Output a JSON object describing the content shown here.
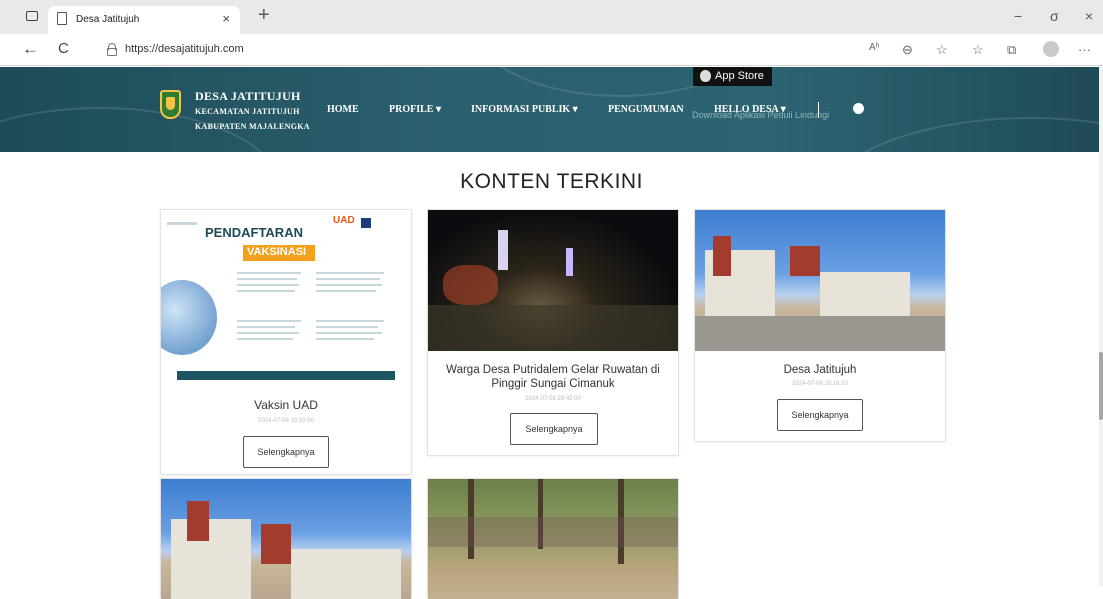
{
  "browser": {
    "tab_title": "Desa Jatitujuh",
    "tab_close": "×",
    "new_tab": "+",
    "url": "https://desajatitujuh.com",
    "nav": {
      "back": "←",
      "refresh": "C"
    },
    "window_controls": {
      "minimize": "−",
      "maximize": "σ",
      "close": "×"
    },
    "toolbar_icons": [
      "read-aloud-icon",
      "zoom-icon",
      "favorites-add-icon",
      "favorites-icon",
      "collections-icon",
      "profile-icon",
      "more-icon"
    ],
    "toolbar_glyphs": {
      "read_aloud": "Aʰ",
      "zoom": "⊖",
      "fav_add": "☆",
      "favorites": "☆",
      "collections": "⧉",
      "more": "···"
    }
  },
  "site": {
    "brand": {
      "title": "DESA JATITUJUH",
      "line1": "KECAMATAN JATITUJUH",
      "line2": "KABUPATEN MAJALENGKA"
    },
    "menu": [
      {
        "label": "HOME"
      },
      {
        "label": "PROFILE ▾"
      },
      {
        "label": "INFORMASI PUBLIK ▾"
      },
      {
        "label": "PENGUMUMAN"
      },
      {
        "label": "HELLO DESA ▾"
      }
    ],
    "app_store": "App Store",
    "download_text": "Download Aplikasi Peduli Lindungi"
  },
  "main": {
    "section_title": "KONTEN TERKINI",
    "cards": [
      {
        "title": "Vaksin UAD",
        "date": "2024-07-08 15:15:00",
        "button": "Selengkapnya",
        "poster": {
          "heading": "PENDAFTARAN",
          "band": "VAKSINASI",
          "logo": "UAD"
        }
      },
      {
        "title": "Warga Desa Putridalem Gelar Ruwatan di Pinggir Sungai Cimanuk",
        "date": "2024-07-08 20:45:00",
        "button": "Selengkapnya"
      },
      {
        "title": "Desa Jatitujuh",
        "date": "2024-07-08 20:16:10",
        "button": "Selengkapnya"
      }
    ]
  }
}
